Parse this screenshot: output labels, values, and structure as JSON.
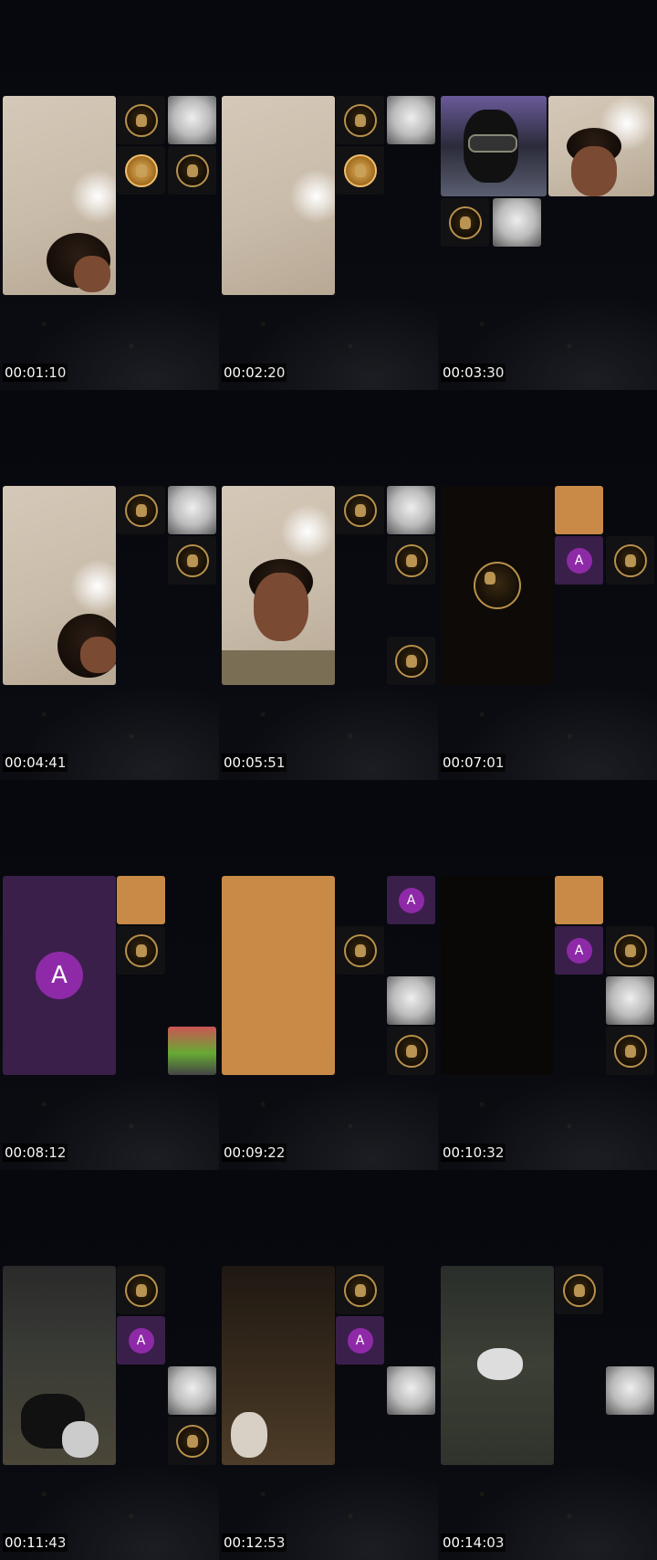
{
  "timestamps": [
    "00:01:10",
    "00:02:20",
    "00:03:30",
    "00:04:41",
    "00:05:51",
    "00:07:01",
    "00:08:12",
    "00:09:22",
    "00:10:32",
    "00:11:43",
    "00:12:53",
    "00:14:03"
  ],
  "avatar_letter": "A",
  "colors": {
    "background": "#05060a",
    "avatar_purple": "#8e2aa8",
    "tile_purple": "#3a1f4a",
    "tile_orange": "#c98a47",
    "coin_gold": "#b8914a"
  }
}
